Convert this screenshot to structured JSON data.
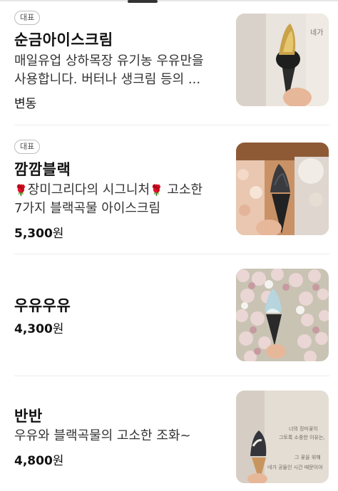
{
  "items": [
    {
      "badge": "대표",
      "name": "순금아이스크림",
      "desc_line1": "매일유업 상하목장 유기농 우유만을",
      "desc_line2": "사용합니다. 버터나 생크림 등의 ...",
      "price_text": "변동",
      "image_icon": "gold-ice-cream-photo",
      "image_caption": "네가"
    },
    {
      "badge": "대표",
      "name": "깜깜블랙",
      "desc_flower_icon": "rose-emoji",
      "desc_part1": "장미그리다의 시그니처",
      "desc_part2": " 고소한",
      "desc_line2": "7가지 블랙곡물 아이스크림",
      "price_num": "5,300",
      "price_unit": "원",
      "image_icon": "black-ice-cream-photo"
    },
    {
      "name": "우유우유",
      "price_num": "4,300",
      "price_unit": "원",
      "image_icon": "milk-ice-cream-flowers-photo"
    },
    {
      "name": "반반",
      "desc_line1": "우유와 블랙곡물의 고소한 조화~",
      "price_num": "4,800",
      "price_unit": "원",
      "image_icon": "half-half-ice-cream-photo",
      "image_text": [
        "너의 장미꽃이",
        "그토록 소중한 이유는,",
        "그 꽃을 위해",
        "네가 공들인 시간 때문이야"
      ]
    }
  ]
}
